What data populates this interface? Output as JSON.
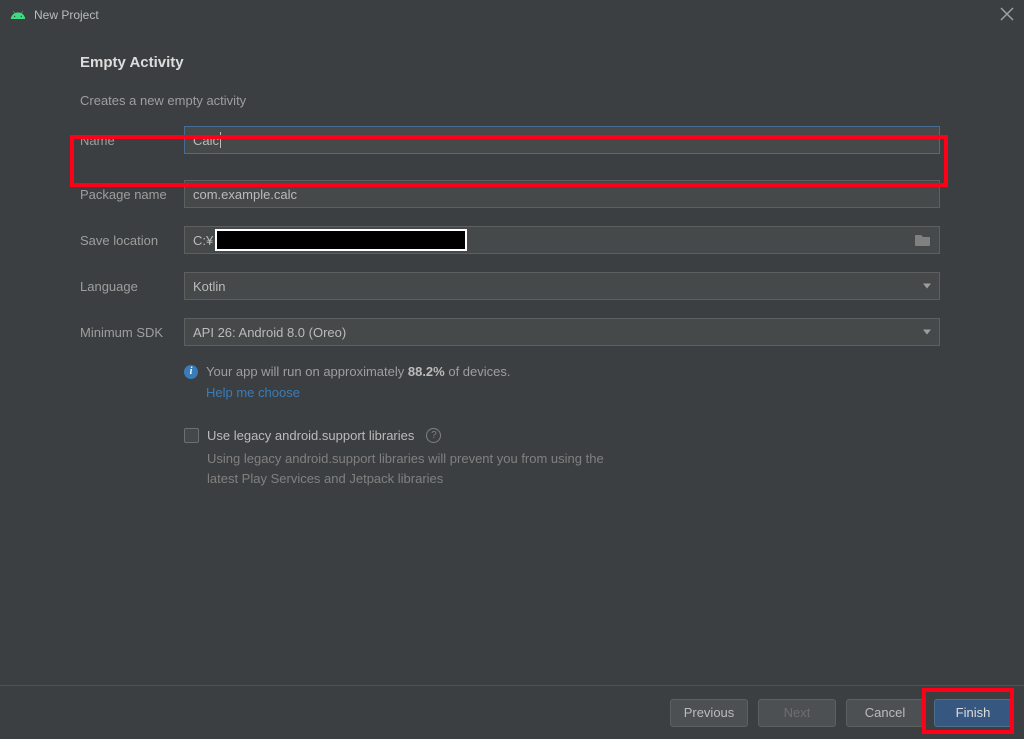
{
  "window": {
    "title": "New Project"
  },
  "header": {
    "title": "Empty Activity",
    "subtitle": "Creates a new empty activity"
  },
  "form": {
    "name": {
      "label": "Name",
      "value": "Calc"
    },
    "package": {
      "label": "Package name",
      "value": "com.example.calc"
    },
    "save": {
      "label": "Save location",
      "prefix": "C:¥"
    },
    "language": {
      "label": "Language",
      "value": "Kotlin"
    },
    "minsdk": {
      "label": "Minimum SDK",
      "value": "API 26: Android 8.0 (Oreo)"
    }
  },
  "info": {
    "prefix": "Your app will run on approximately ",
    "percent": "88.2%",
    "suffix": " of devices.",
    "help": "Help me choose"
  },
  "legacy": {
    "label": "Use legacy android.support libraries",
    "note": "Using legacy android.support libraries will prevent you from using the latest Play Services and Jetpack libraries"
  },
  "buttons": {
    "previous": "Previous",
    "next": "Next",
    "cancel": "Cancel",
    "finish": "Finish"
  }
}
